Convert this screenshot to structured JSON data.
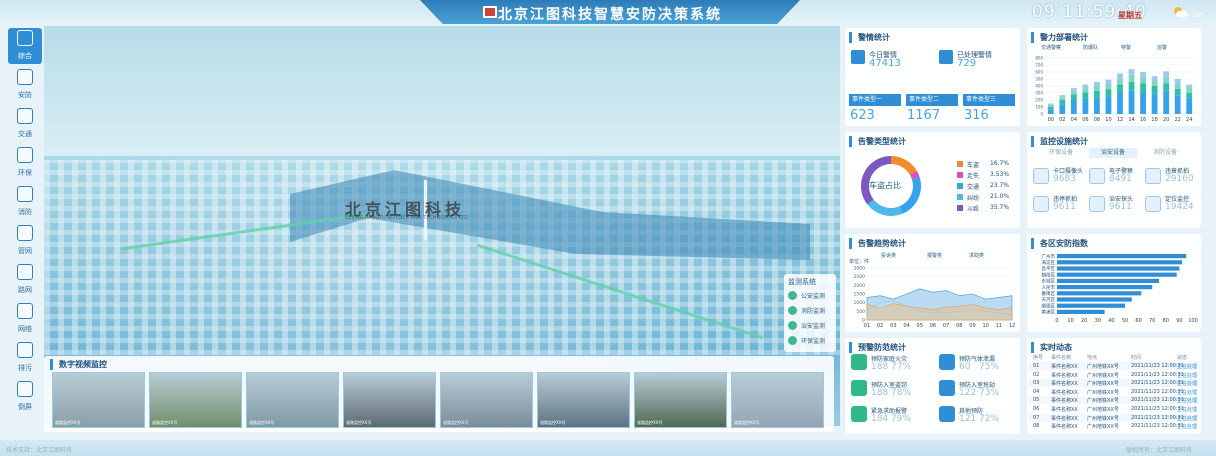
{
  "header": {
    "title": "北京江图科技智慧安防决策系统",
    "clock": "09:11:59:40",
    "date": "星期五",
    "temp": "38°"
  },
  "nav": [
    {
      "label": "综合",
      "icon": "grid-icon"
    },
    {
      "label": "安防",
      "icon": "shield-icon"
    },
    {
      "label": "交通",
      "icon": "road-icon"
    },
    {
      "label": "环保",
      "icon": "recycle-icon"
    },
    {
      "label": "消防",
      "icon": "fire-extinguisher-icon"
    },
    {
      "label": "管网",
      "icon": "pipe-icon"
    },
    {
      "label": "路网",
      "icon": "route-icon"
    },
    {
      "label": "网络",
      "icon": "globe-icon"
    },
    {
      "label": "排污",
      "icon": "drain-icon"
    },
    {
      "label": "倒屏",
      "icon": "screen-icon"
    }
  ],
  "map": {
    "watermark": "北京江图科技",
    "watermark_sub": "BEIJING JIANGTU SCIENCE AND TECHNOLOGY LTD"
  },
  "monitor_legend": {
    "title": "监测系统",
    "items": [
      "公安监测",
      "消防监测",
      "治安监测",
      "环保监测"
    ]
  },
  "video": {
    "title": "数字视频监控",
    "cams": [
      {
        "label": "道路监控XX号"
      },
      {
        "label": "道路监控XX号"
      },
      {
        "label": "道路监控XX号"
      },
      {
        "label": "道路监控XX号"
      },
      {
        "label": "道路监控XX号"
      },
      {
        "label": "道路监控XX号"
      },
      {
        "label": "道路监控XX号"
      },
      {
        "label": "道路监控XX号"
      }
    ]
  },
  "alarm": {
    "title": "警情统计",
    "today_label": "今日警情",
    "today_value": "47413",
    "handled_label": "已处理警情",
    "handled_value": "729",
    "types": [
      {
        "label": "事件类型一",
        "value": "623"
      },
      {
        "label": "事件类型二",
        "value": "1167"
      },
      {
        "label": "事件类型三",
        "value": "316"
      }
    ]
  },
  "dispatch": {
    "title": "警力部署统计",
    "legend": [
      "交通警察",
      "防爆队",
      "特警",
      "巡警"
    ],
    "chart_data": {
      "type": "bar",
      "categories": [
        "00",
        "02",
        "04",
        "06",
        "08",
        "10",
        "12",
        "14",
        "16",
        "18",
        "20",
        "22",
        "24"
      ],
      "ylim": [
        0,
        800
      ],
      "yticks": [
        "0",
        "100",
        "200",
        "300",
        "400",
        "500",
        "600",
        "700",
        "800"
      ],
      "series": [
        {
          "name": "交通警察",
          "values": [
            60,
            140,
            200,
            220,
            230,
            240,
            300,
            330,
            300,
            290,
            320,
            260,
            220
          ]
        },
        {
          "name": "防爆队",
          "values": [
            40,
            60,
            80,
            90,
            100,
            110,
            120,
            130,
            140,
            110,
            120,
            100,
            80
          ]
        },
        {
          "name": "特警",
          "values": [
            30,
            40,
            50,
            60,
            70,
            80,
            90,
            100,
            90,
            80,
            90,
            80,
            70
          ]
        },
        {
          "name": "巡警",
          "values": [
            20,
            30,
            40,
            50,
            60,
            60,
            70,
            80,
            70,
            60,
            80,
            60,
            50
          ]
        }
      ]
    }
  },
  "alarm_types": {
    "title": "告警类型统计",
    "center_label": "车盗占比",
    "chart_data": {
      "type": "pie",
      "labels": [
        "车盗",
        "走失",
        "交通",
        "纠纷",
        "斗殴"
      ],
      "values": [
        16.7,
        3.53,
        23.7,
        21.0,
        35.7
      ],
      "display": [
        "16.7%",
        "3.53%",
        "23.7%",
        "21.0%",
        "35.7%"
      ],
      "colors": [
        "#f28b2c",
        "#d84fc2",
        "#36a2eb",
        "#4fb8e8",
        "#7e57c2"
      ]
    }
  },
  "monitor_fac": {
    "title": "监控设施统计",
    "tabs": [
      "环保设备",
      "治安设备",
      "消防设备"
    ],
    "active_tab": 1,
    "items": [
      {
        "label": "卡口摄像头",
        "value": "9683"
      },
      {
        "label": "电子警察",
        "value": "8491"
      },
      {
        "label": "违章抓拍",
        "value": "29160"
      },
      {
        "label": "违停抓拍",
        "value": "9611"
      },
      {
        "label": "治安探头",
        "value": "9611"
      },
      {
        "label": "定位监控",
        "value": "19424"
      }
    ]
  },
  "trend": {
    "title": "告警趋势统计",
    "legend": [
      "投诉类",
      "报警类",
      "求助类"
    ],
    "unit": "单位：件",
    "chart_data": {
      "type": "area",
      "x": [
        "01",
        "02",
        "03",
        "04",
        "05",
        "06",
        "07",
        "08",
        "09",
        "10",
        "11",
        "12"
      ],
      "ylim": [
        0,
        3000
      ],
      "yticks": [
        "0",
        "500",
        "1000",
        "1500",
        "2000",
        "2500",
        "3000"
      ],
      "series": [
        {
          "name": "投诉类",
          "values": [
            900,
            700,
            950,
            800,
            700,
            600,
            750,
            800,
            900,
            700,
            600,
            700
          ]
        },
        {
          "name": "报警类",
          "values": [
            1300,
            1400,
            1200,
            1500,
            1800,
            1600,
            1700,
            1400,
            1500,
            1200,
            1300,
            1400
          ]
        },
        {
          "name": "求助类",
          "values": [
            500,
            1000,
            1100,
            800,
            500,
            400,
            400,
            500,
            600,
            500,
            400,
            300
          ]
        }
      ]
    }
  },
  "district": {
    "title": "各区安防指数",
    "chart_data": {
      "type": "bar",
      "categories": [
        "广州市",
        "海淀区",
        "昌平区",
        "朝阳区",
        "东城区",
        "人民市",
        "番禺区",
        "天河区",
        "顺德区",
        "黄浦区"
      ],
      "values": [
        95,
        92,
        90,
        88,
        75,
        70,
        62,
        55,
        50,
        35
      ],
      "xlim": [
        0,
        100
      ],
      "xticks": [
        "0",
        "10",
        "20",
        "30",
        "40",
        "50",
        "60",
        "70",
        "80",
        "90",
        "100"
      ]
    }
  },
  "warning": {
    "title": "预警防范统计",
    "items": [
      {
        "label": "预防家庭火灾",
        "value": "188",
        "pct": "77%"
      },
      {
        "label": "预防气体泄漏",
        "value": "60",
        "pct": "75%"
      },
      {
        "label": "预防入室盗窃",
        "value": "188",
        "pct": "78%"
      },
      {
        "label": "预防入室抢劫",
        "value": "122",
        "pct": "73%"
      },
      {
        "label": "紧急求助报警",
        "value": "184",
        "pct": "79%"
      },
      {
        "label": "其他预防",
        "value": "121",
        "pct": "72%"
      }
    ]
  },
  "realtime": {
    "title": "实时动态",
    "headers": [
      "序号",
      "事件名称",
      "地点",
      "时间",
      "状态"
    ],
    "rows": [
      [
        "01",
        "事件名称XX",
        "广州地铁XX号",
        "2021/11/23 12:00:31",
        "正在处理"
      ],
      [
        "02",
        "事件名称XX",
        "广州地铁XX号",
        "2021/11/23 12:00:31",
        "正在处理"
      ],
      [
        "03",
        "事件名称XX",
        "广州地铁XX号",
        "2021/11/23 12:00:31",
        "正在处理"
      ],
      [
        "04",
        "事件名称XX",
        "广州地铁XX号",
        "2021/11/23 12:00:31",
        "正在处理"
      ],
      [
        "05",
        "事件名称XX",
        "广州地铁XX号",
        "2021/11/23 12:00:31",
        "正在处理"
      ],
      [
        "06",
        "事件名称XX",
        "广州地铁XX号",
        "2021/11/23 12:00:31",
        "正在处理"
      ],
      [
        "07",
        "事件名称XX",
        "广州地铁XX号",
        "2021/11/23 12:00:31",
        "正在处理"
      ],
      [
        "08",
        "事件名称XX",
        "广州地铁XX号",
        "2021/11/23 12:00:31",
        "正在处理"
      ]
    ]
  },
  "footer": {
    "left": "技术支持：北京江图科技",
    "right": "版权所有：北京江图科技"
  }
}
